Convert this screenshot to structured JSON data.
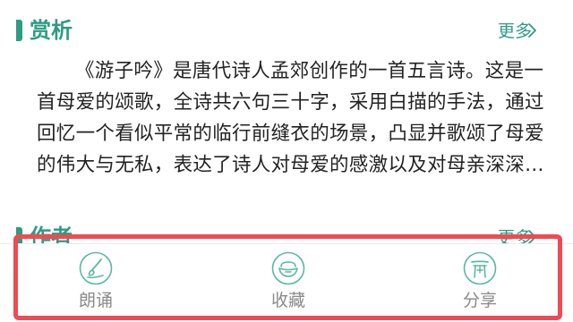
{
  "appreciation": {
    "title": "赏析",
    "more_label": "更多",
    "paragraph": "《游子吟》是唐代诗人孟郊创作的一首五言诗。这是一首母爱的颂歌，全诗共六句三十字，采用白描的手法，通过回忆一个看似平常的临行前缝衣的场景，凸显并歌颂了母爱的伟大与无私，表达了诗人对母爱的感激以及对母亲深深…"
  },
  "author": {
    "title": "作者",
    "more_label": "更多"
  },
  "toolbar": {
    "items": [
      {
        "label": "朗诵",
        "icon": "brush-icon"
      },
      {
        "label": "收藏",
        "icon": "collect-icon"
      },
      {
        "label": "分享",
        "icon": "share-icon"
      }
    ]
  },
  "colors": {
    "accent": "#2e9b84",
    "highlight": "#ee4b54",
    "text": "#222222",
    "muted": "#8a8a8a"
  }
}
